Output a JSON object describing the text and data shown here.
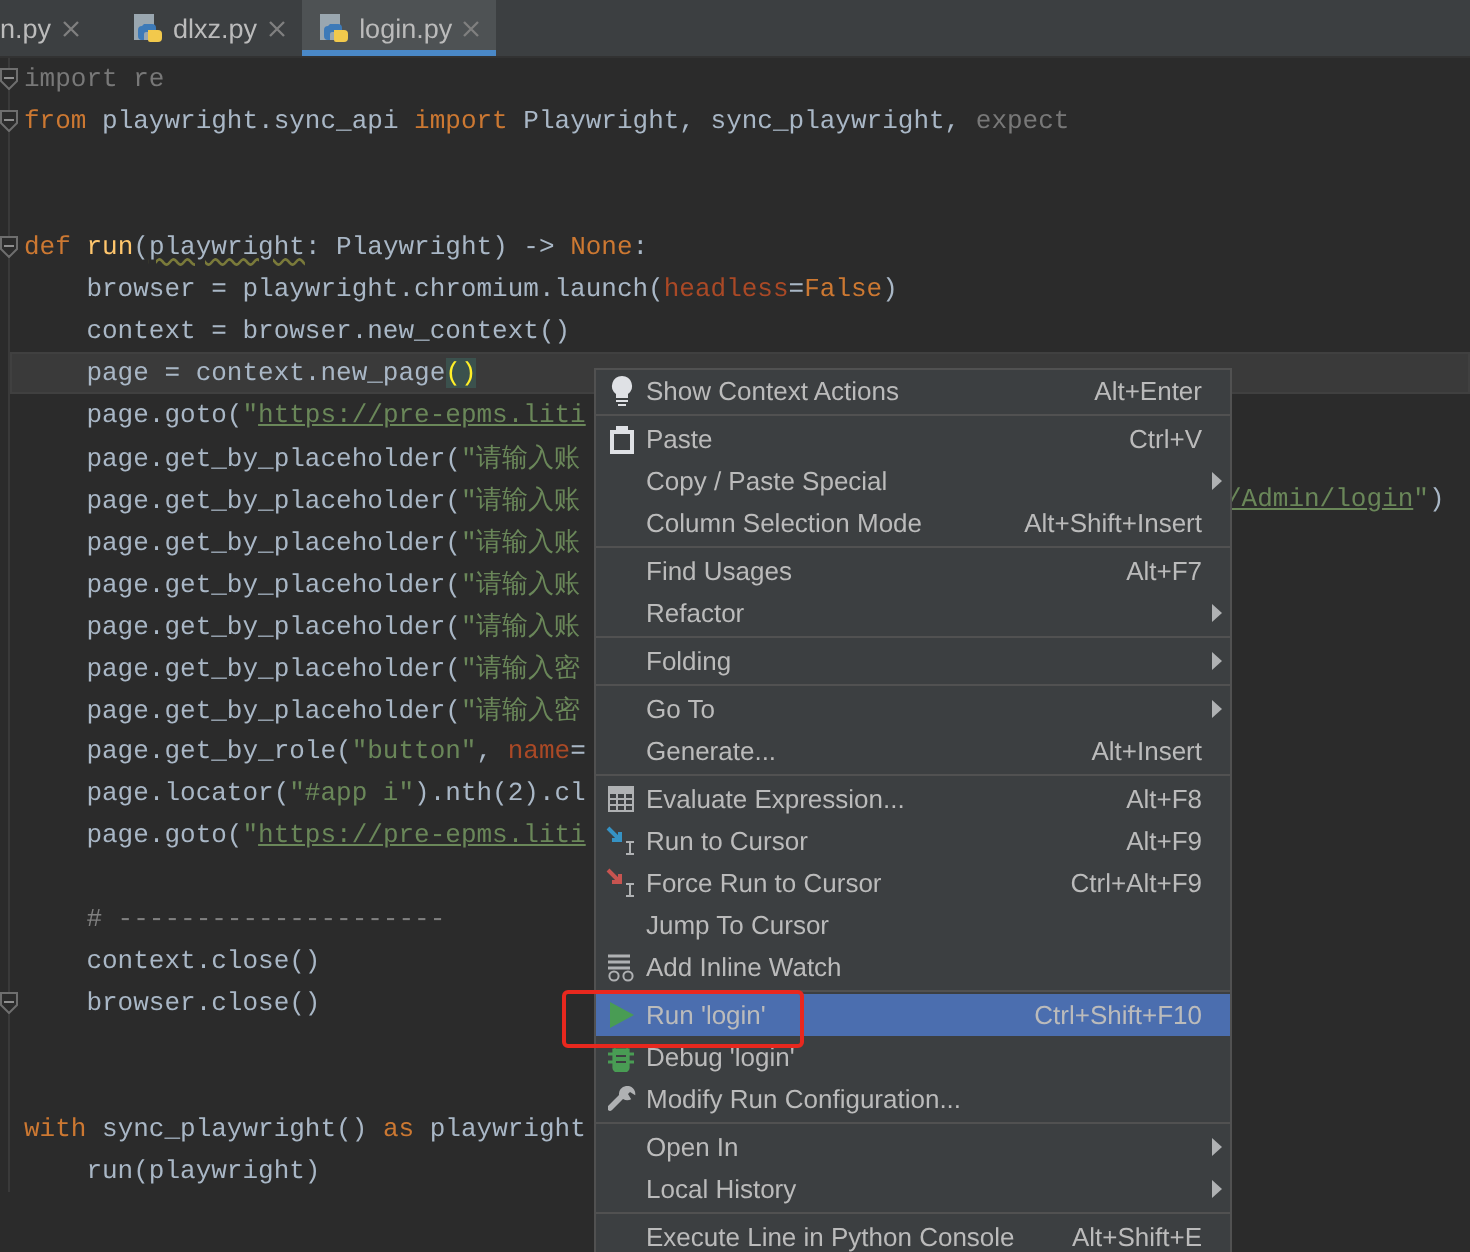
{
  "tabs": [
    {
      "label": "n.py",
      "selected": false
    },
    {
      "label": "dlxz.py",
      "selected": false
    },
    {
      "label": "login.py",
      "selected": true
    }
  ],
  "editor": {
    "lines": [
      {
        "fold": true,
        "current": false,
        "segments": [
          {
            "kind": "unused",
            "text": "import re"
          }
        ]
      },
      {
        "fold": true,
        "current": false,
        "segments": [
          {
            "kind": "kw",
            "text": "from"
          },
          {
            "kind": "plain",
            "text": " playwright.sync_api "
          },
          {
            "kind": "kw",
            "text": "import"
          },
          {
            "kind": "plain",
            "text": " Playwright, sync_playwright, "
          },
          {
            "kind": "unused",
            "text": "expect"
          }
        ]
      },
      {
        "fold": false,
        "current": false
      },
      {
        "fold": false,
        "current": false
      },
      {
        "fold": true,
        "current": false,
        "segments": [
          {
            "kind": "kw",
            "text": "def "
          },
          {
            "kind": "fn",
            "text": "run"
          },
          {
            "kind": "plain",
            "text": "("
          },
          {
            "kind": "typo",
            "text": "playwright"
          },
          {
            "kind": "plain",
            "text": ": Playwright) -> "
          },
          {
            "kind": "kw",
            "text": "None"
          },
          {
            "kind": "plain",
            "text": ":"
          }
        ]
      },
      {
        "fold": false,
        "current": false,
        "segments": [
          {
            "kind": "plain",
            "text": "    browser = playwright.chromium.launch("
          },
          {
            "kind": "param",
            "text": "headless"
          },
          {
            "kind": "plain",
            "text": "="
          },
          {
            "kind": "kw",
            "text": "False"
          },
          {
            "kind": "plain",
            "text": ")"
          }
        ]
      },
      {
        "fold": false,
        "current": false,
        "segments": [
          {
            "kind": "plain",
            "text": "    context = browser.new_context()"
          }
        ]
      },
      {
        "fold": false,
        "current": true,
        "segments": [
          {
            "kind": "plain",
            "text": "    page = context.new_page"
          },
          {
            "kind": "brace",
            "text": "()"
          }
        ]
      },
      {
        "fold": false,
        "current": false,
        "segments": [
          {
            "kind": "plain",
            "text": "    page.goto("
          },
          {
            "kind": "str",
            "text": "\""
          },
          {
            "kind": "url",
            "text": "https://pre-epms.liti"
          }
        ]
      },
      {
        "fold": false,
        "current": false,
        "segments": [
          {
            "kind": "plain",
            "text": "    page.get_by_placeholder("
          },
          {
            "kind": "str",
            "text": "\"请输入账"
          }
        ]
      },
      {
        "fold": false,
        "current": false,
        "segments": [
          {
            "kind": "plain",
            "text": "    page.get_by_placeholder("
          },
          {
            "kind": "str",
            "text": "\"请输入账"
          }
        ],
        "tail": [
          {
            "kind": "url",
            "text": "/Admin/login"
          },
          {
            "kind": "str",
            "text": "\""
          },
          {
            "kind": "plain",
            "text": ")"
          }
        ]
      },
      {
        "fold": false,
        "current": false,
        "segments": [
          {
            "kind": "plain",
            "text": "    page.get_by_placeholder("
          },
          {
            "kind": "str",
            "text": "\"请输入账"
          }
        ]
      },
      {
        "fold": false,
        "current": false,
        "segments": [
          {
            "kind": "plain",
            "text": "    page.get_by_placeholder("
          },
          {
            "kind": "str",
            "text": "\"请输入账"
          }
        ]
      },
      {
        "fold": false,
        "current": false,
        "segments": [
          {
            "kind": "plain",
            "text": "    page.get_by_placeholder("
          },
          {
            "kind": "str",
            "text": "\"请输入账"
          }
        ]
      },
      {
        "fold": false,
        "current": false,
        "segments": [
          {
            "kind": "plain",
            "text": "    page.get_by_placeholder("
          },
          {
            "kind": "str",
            "text": "\"请输入密"
          }
        ]
      },
      {
        "fold": false,
        "current": false,
        "segments": [
          {
            "kind": "plain",
            "text": "    page.get_by_placeholder("
          },
          {
            "kind": "str",
            "text": "\"请输入密"
          }
        ]
      },
      {
        "fold": false,
        "current": false,
        "segments": [
          {
            "kind": "plain",
            "text": "    page.get_by_role("
          },
          {
            "kind": "str",
            "text": "\"button\""
          },
          {
            "kind": "plain",
            "text": ", "
          },
          {
            "kind": "param",
            "text": "name"
          },
          {
            "kind": "plain",
            "text": "="
          }
        ]
      },
      {
        "fold": false,
        "current": false,
        "segments": [
          {
            "kind": "plain",
            "text": "    page.locator("
          },
          {
            "kind": "str",
            "text": "\"#app i\""
          },
          {
            "kind": "plain",
            "text": ").nth(2).cl"
          }
        ]
      },
      {
        "fold": false,
        "current": false,
        "segments": [
          {
            "kind": "plain",
            "text": "    page.goto("
          },
          {
            "kind": "str",
            "text": "\""
          },
          {
            "kind": "url",
            "text": "https://pre-epms.liti"
          }
        ]
      },
      {
        "fold": false,
        "current": false
      },
      {
        "fold": false,
        "current": false,
        "segments": [
          {
            "kind": "comment",
            "text": "    # ---------------------"
          }
        ]
      },
      {
        "fold": false,
        "current": false,
        "segments": [
          {
            "kind": "plain",
            "text": "    context.close()"
          }
        ]
      },
      {
        "fold": true,
        "current": false,
        "segments": [
          {
            "kind": "plain",
            "text": "    browser.close()"
          }
        ]
      },
      {
        "fold": false,
        "current": false
      },
      {
        "fold": false,
        "current": false
      },
      {
        "fold": false,
        "current": false,
        "segments": [
          {
            "kind": "kw",
            "text": "with"
          },
          {
            "kind": "plain",
            "text": " sync_playwright() "
          },
          {
            "kind": "kw",
            "text": "as"
          },
          {
            "kind": "plain",
            "text": " playwright"
          }
        ]
      },
      {
        "fold": false,
        "current": false,
        "segments": [
          {
            "kind": "plain",
            "text": "    run(playwright)"
          }
        ]
      }
    ]
  },
  "context_menu": {
    "items": [
      {
        "kind": "item",
        "label": "Show Context Actions",
        "shortcut": "Alt+Enter",
        "submenu": false,
        "selected": false
      },
      {
        "kind": "separator"
      },
      {
        "kind": "item",
        "label": "Paste",
        "shortcut": "Ctrl+V",
        "submenu": false,
        "selected": false
      },
      {
        "kind": "item",
        "label": "Copy / Paste Special",
        "submenu": true,
        "selected": false
      },
      {
        "kind": "item",
        "label": "Column Selection Mode",
        "shortcut": "Alt+Shift+Insert",
        "submenu": false,
        "selected": false
      },
      {
        "kind": "separator"
      },
      {
        "kind": "item",
        "label": "Find Usages",
        "shortcut": "Alt+F7",
        "submenu": false,
        "selected": false
      },
      {
        "kind": "item",
        "label": "Refactor",
        "submenu": true,
        "selected": false
      },
      {
        "kind": "separator"
      },
      {
        "kind": "item",
        "label": "Folding",
        "submenu": true,
        "selected": false
      },
      {
        "kind": "separator"
      },
      {
        "kind": "item",
        "label": "Go To",
        "submenu": true,
        "selected": false
      },
      {
        "kind": "item",
        "label": "Generate...",
        "shortcut": "Alt+Insert",
        "submenu": false,
        "selected": false
      },
      {
        "kind": "separator"
      },
      {
        "kind": "item",
        "label": "Evaluate Expression...",
        "shortcut": "Alt+F8",
        "submenu": false,
        "selected": false
      },
      {
        "kind": "item",
        "label": "Run to Cursor",
        "shortcut": "Alt+F9",
        "submenu": false,
        "selected": false
      },
      {
        "kind": "item",
        "label": "Force Run to Cursor",
        "shortcut": "Ctrl+Alt+F9",
        "submenu": false,
        "selected": false
      },
      {
        "kind": "item",
        "label": "Jump To Cursor",
        "submenu": false,
        "selected": false
      },
      {
        "kind": "item",
        "label": "Add Inline Watch",
        "submenu": false,
        "selected": false
      },
      {
        "kind": "separator"
      },
      {
        "kind": "item",
        "label": "Run 'login'",
        "shortcut": "Ctrl+Shift+F10",
        "submenu": false,
        "selected": true
      },
      {
        "kind": "item",
        "label": "Debug 'login'",
        "submenu": false,
        "selected": false
      },
      {
        "kind": "item",
        "label": "Modify Run Configuration...",
        "submenu": false,
        "selected": false
      },
      {
        "kind": "separator"
      },
      {
        "kind": "item",
        "label": "Open In",
        "submenu": true,
        "selected": false
      },
      {
        "kind": "item",
        "label": "Local History",
        "submenu": true,
        "selected": false
      },
      {
        "kind": "separator"
      },
      {
        "kind": "item",
        "label": "Execute Line in Python Console",
        "shortcut": "Alt+Shift+E",
        "submenu": false,
        "selected": false
      }
    ]
  }
}
